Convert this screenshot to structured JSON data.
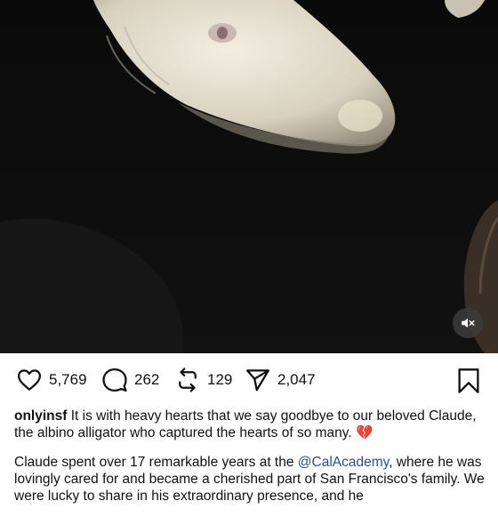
{
  "post": {
    "media": {
      "description_icon": "alligator-photo",
      "muted": true
    },
    "actions": {
      "likes": "5,769",
      "comments": "262",
      "reposts": "129",
      "shares": "2,047"
    },
    "caption": {
      "username": "onlyinsf",
      "text_line_1": " It is with heavy hearts that we say goodbye to our beloved Claude, the albino alligator who captured the hearts of so many. ",
      "emoji": "💔",
      "p2_before": "Claude spent over 17 remarkable years at the ",
      "mention": "@CalAcademy",
      "p2_after": ", where he was lovingly cared for and became a cherished part of San Francisco's family. We were lucky to share in his extraordinary presence, and he"
    }
  },
  "colors": {
    "mention": "#2b4f8f",
    "text": "#111111",
    "media_bg": "#050505"
  }
}
